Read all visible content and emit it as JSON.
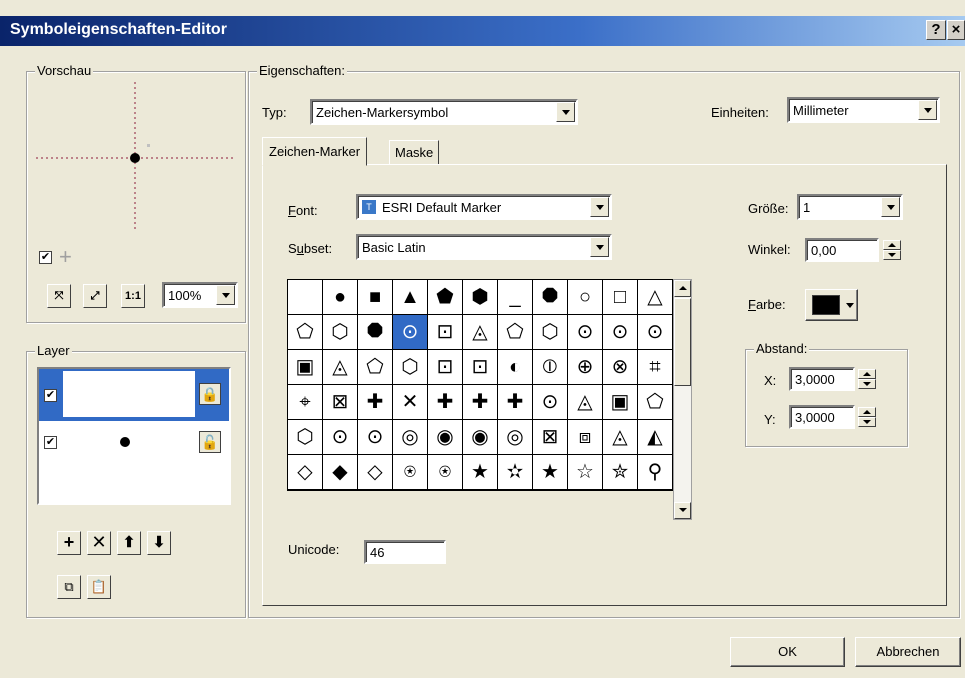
{
  "window": {
    "title": "Symboleigenschaften-Editor",
    "help_label": "?",
    "close_label": "×"
  },
  "preview": {
    "label": "Vorschau",
    "zoom_value": "100%",
    "fit_icon": "collapse-icon",
    "expand_icon": "expand-icon",
    "actual_size_label": "1:1"
  },
  "layer": {
    "label": "Layer",
    "items": [
      {
        "checked": true,
        "selected": true
      },
      {
        "checked": true,
        "selected": false
      }
    ]
  },
  "properties": {
    "label": "Eigenschaften:",
    "type_label": "Typ:",
    "type_value": "Zeichen-Markersymbol",
    "units_label": "Einheiten:",
    "units_value": "Millimeter"
  },
  "tabs": [
    {
      "label": "Zeichen-Marker",
      "active": true
    },
    {
      "label": "Maske",
      "active": false
    }
  ],
  "marker": {
    "font_label_pre": "",
    "font_label_u": "F",
    "font_label_post": "ont:",
    "font_value": "ESRI Default Marker",
    "subset_label_pre": "S",
    "subset_label_u": "u",
    "subset_label_post": "bset:",
    "subset_value": "Basic Latin",
    "size_label": "Größe:",
    "size_value": "1",
    "angle_label": "Winkel:",
    "angle_value": "0,00",
    "color_label_u": "F",
    "color_label_post": "arbe:",
    "color_value": "#000000",
    "offset_label": "Abstand:",
    "x_label": "X:",
    "x_value": "3,0000",
    "y_label": "Y:",
    "y_value": "3,0000",
    "unicode_label": "Unicode:",
    "unicode_value": "46"
  },
  "glyphs": [
    [
      "",
      "●",
      "■",
      "▲",
      "⬟",
      "⬢",
      "_",
      "⯃",
      "○",
      "□",
      "△"
    ],
    [
      "⬠",
      "⬡",
      "⯃",
      "⊙",
      "⊡",
      "◬",
      "⬠",
      "⬡",
      "⊙",
      "⊙",
      "⊙"
    ],
    [
      "▣",
      "◬",
      "⬠",
      "⬡",
      "⊡",
      "⊡",
      "◐",
      "⦶",
      "⊕",
      "⊗",
      "⌗"
    ],
    [
      "⌖",
      "⊠",
      "✚",
      "✕",
      "✚",
      "✚",
      "✚",
      "⊙",
      "◬",
      "▣",
      "⬠"
    ],
    [
      "⬡",
      "⊙",
      "⊙",
      "◎",
      "◉",
      "◉",
      "◎",
      "⊠",
      "⧈",
      "◬",
      "◭"
    ],
    [
      "◇",
      "◆",
      "◇",
      "⍟",
      "⍟",
      "★",
      "✫",
      "★",
      "☆",
      "✮",
      "⚲"
    ]
  ],
  "buttons": {
    "ok": "OK",
    "cancel": "Abbrechen"
  }
}
